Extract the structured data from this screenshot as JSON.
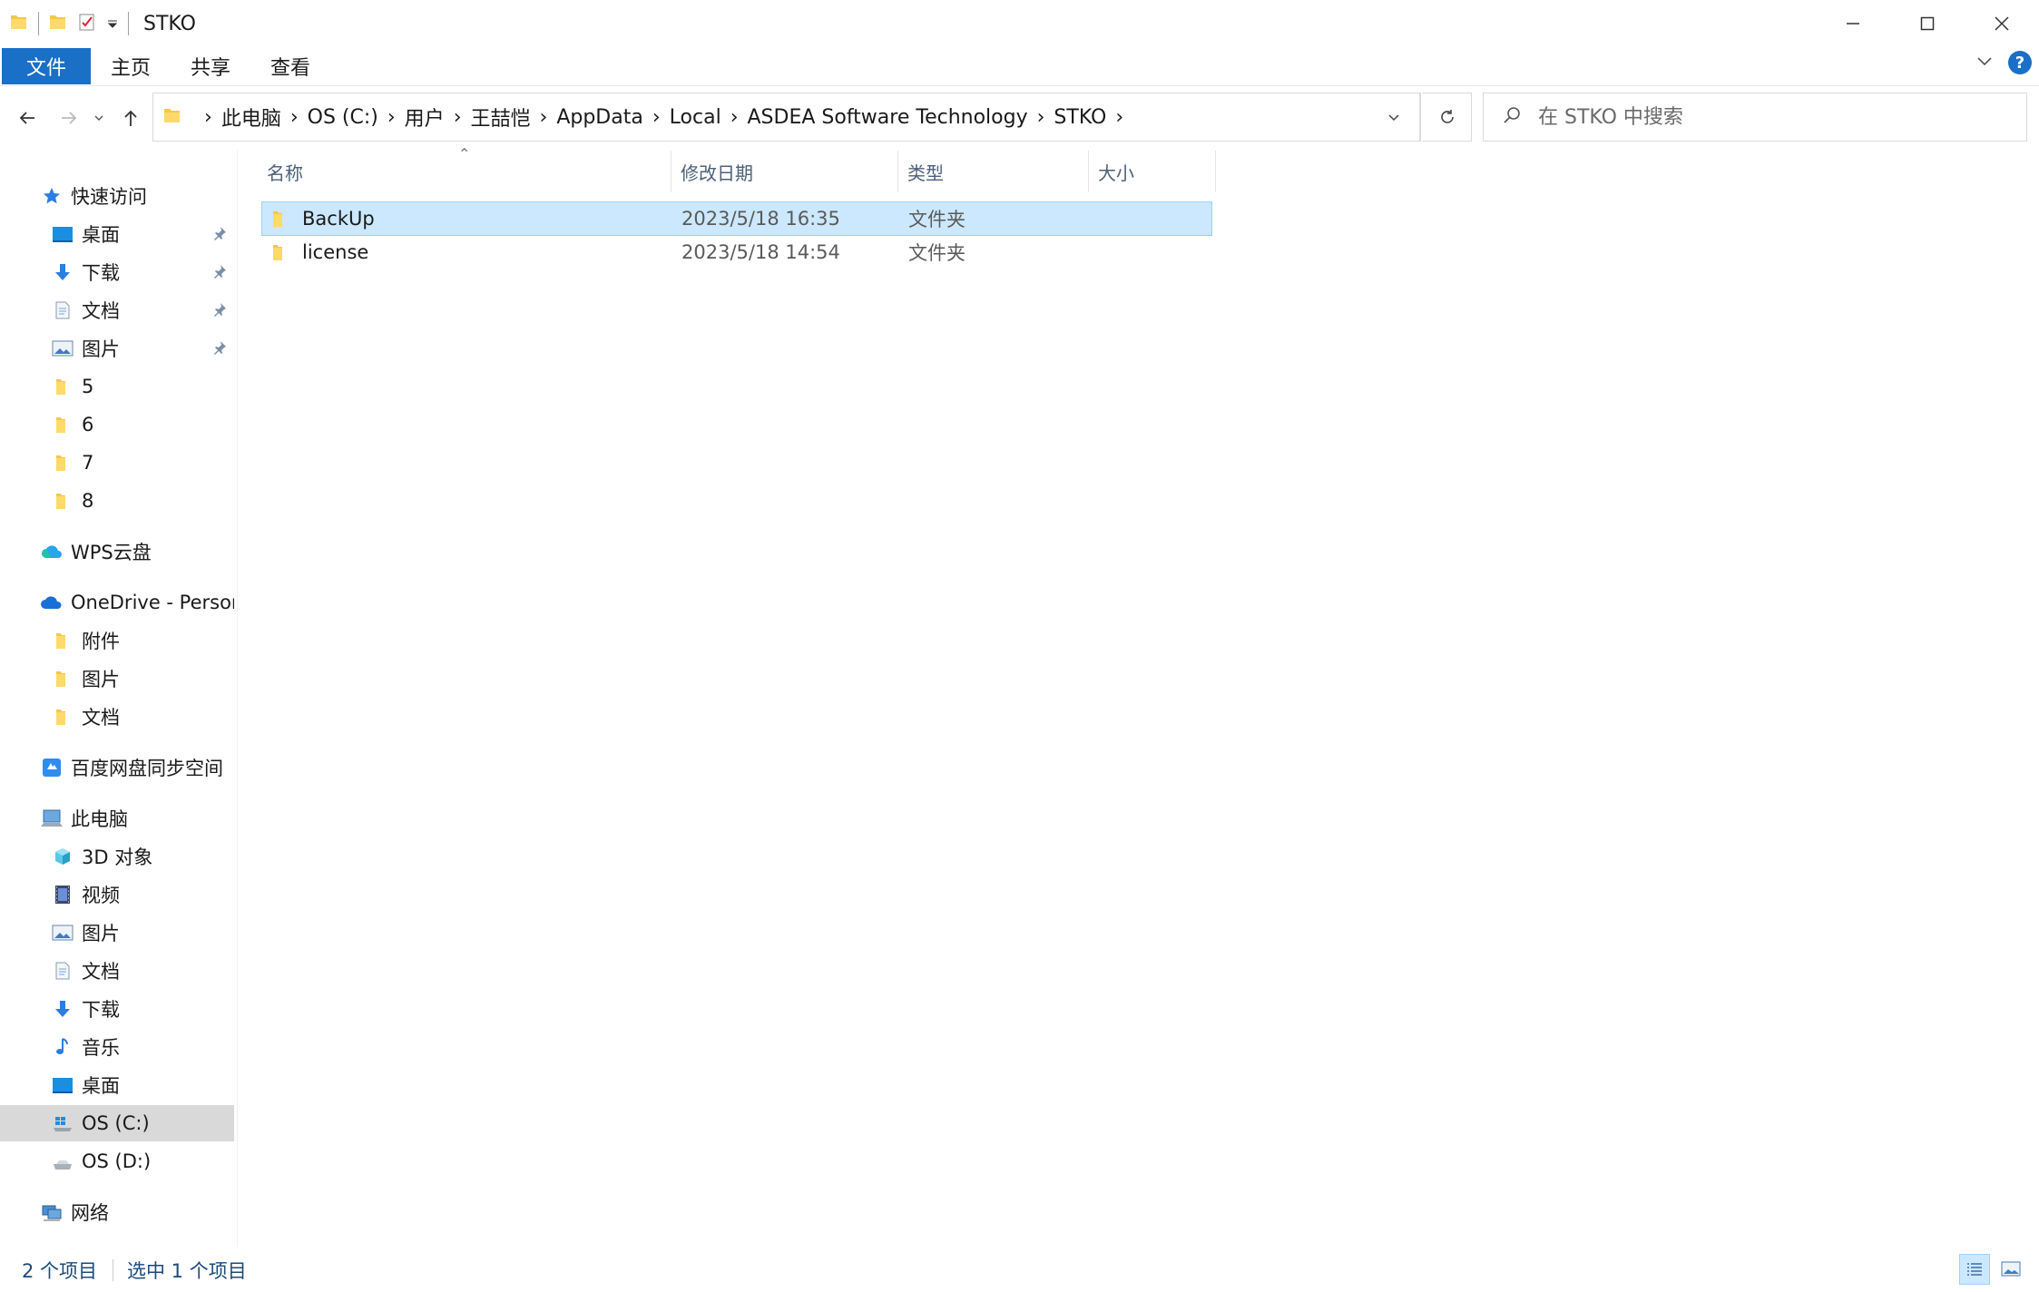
{
  "window": {
    "title": "STKO"
  },
  "ribbon": {
    "tabs": [
      "文件",
      "主页",
      "共享",
      "查看"
    ]
  },
  "address": {
    "crumbs": [
      "此电脑",
      "OS (C:)",
      "用户",
      "王喆恺",
      "AppData",
      "Local",
      "ASDEA Software Technology",
      "STKO"
    ]
  },
  "search": {
    "placeholder": "在 STKO 中搜索"
  },
  "nav": {
    "quick_access": "快速访问",
    "quick_items": [
      "桌面",
      "下载",
      "文档",
      "图片",
      "5",
      "6",
      "7",
      "8"
    ],
    "wps": "WPS云盘",
    "onedrive": "OneDrive - Person",
    "onedrive_items": [
      "附件",
      "图片",
      "文档"
    ],
    "baidu": "百度网盘同步空间",
    "this_pc": "此电脑",
    "pc_items": [
      "3D 对象",
      "视频",
      "图片",
      "文档",
      "下载",
      "音乐",
      "桌面",
      "OS (C:)",
      "OS (D:)"
    ],
    "network": "网络"
  },
  "columns": {
    "name": "名称",
    "date": "修改日期",
    "type": "类型",
    "size": "大小"
  },
  "files": [
    {
      "name": "BackUp",
      "date": "2023/5/18 16:35",
      "type": "文件夹",
      "size": ""
    },
    {
      "name": "license",
      "date": "2023/5/18 14:54",
      "type": "文件夹",
      "size": ""
    }
  ],
  "status": {
    "count": "2 个项目",
    "selected": "选中 1 个项目"
  },
  "colors": {
    "accent": "#1a6fc6",
    "selection": "#cce8ff",
    "folder": "#f5c84c"
  }
}
